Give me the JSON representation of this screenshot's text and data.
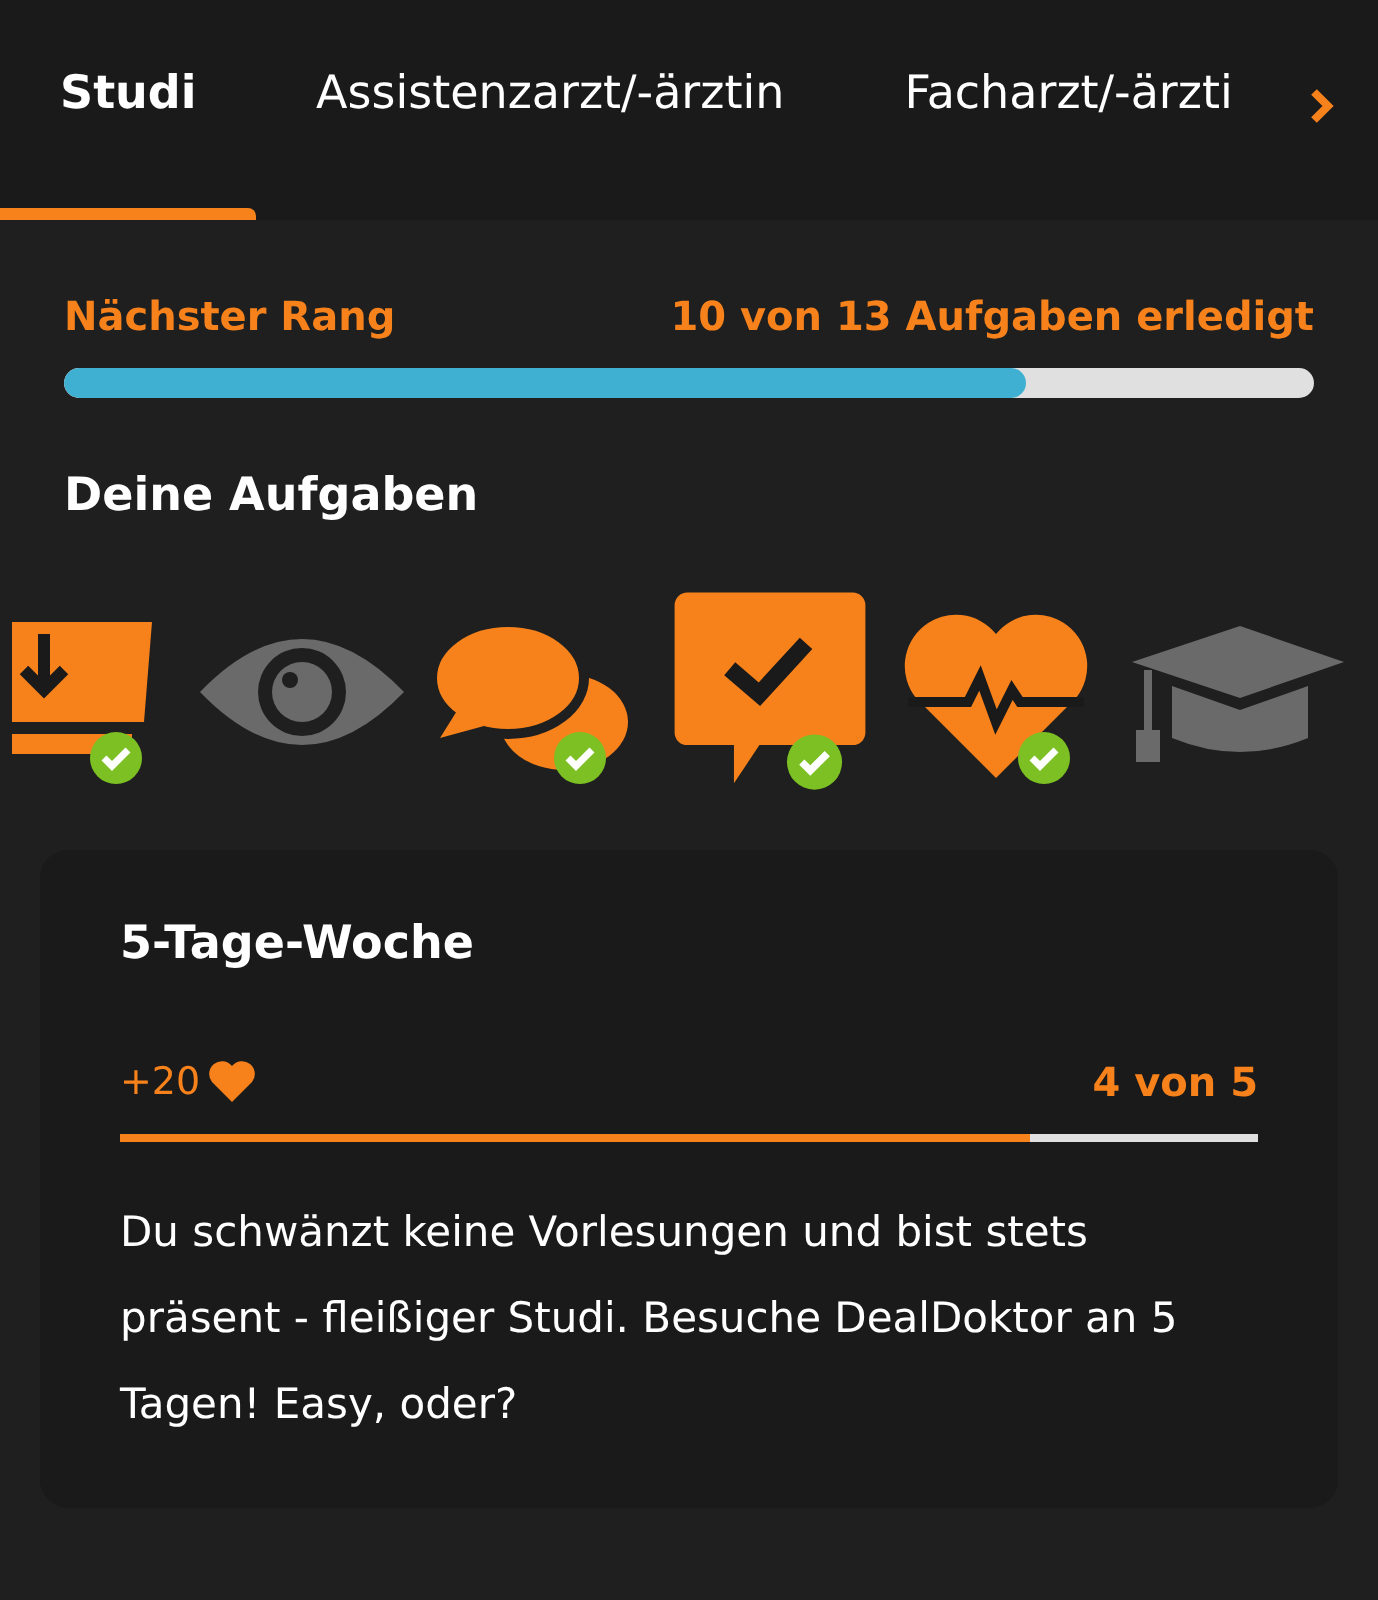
{
  "tabs": [
    {
      "label": "Studi",
      "selected": true
    },
    {
      "label": "Assistenzarzt/-ärztin",
      "selected": false
    },
    {
      "label": "Facharzt/-ärzti",
      "selected": false
    }
  ],
  "rank": {
    "label": "Nächster Rang",
    "count": "10 von 13 Aufgaben erledigt",
    "level": 0.77
  },
  "tasks_title": "Deine Aufgaben",
  "tasks": [
    {
      "kind": "download",
      "done": true,
      "selected": false
    },
    {
      "kind": "eye",
      "done": false,
      "selected": false
    },
    {
      "kind": "chats",
      "done": true,
      "selected": false
    },
    {
      "kind": "chat-check",
      "done": true,
      "selected": true
    },
    {
      "kind": "heart",
      "done": true,
      "selected": false
    },
    {
      "kind": "cap",
      "done": false,
      "selected": false
    }
  ],
  "card": {
    "title": "5-Tage-Woche",
    "reward": "+20",
    "progress": "4 von 5",
    "level": 0.8,
    "text": "Du schwänzt keine Vorlesungen und bist stets präsent - fleißiger Studi. Besuche DealDoktor an 5 Tagen! Easy, oder?"
  }
}
